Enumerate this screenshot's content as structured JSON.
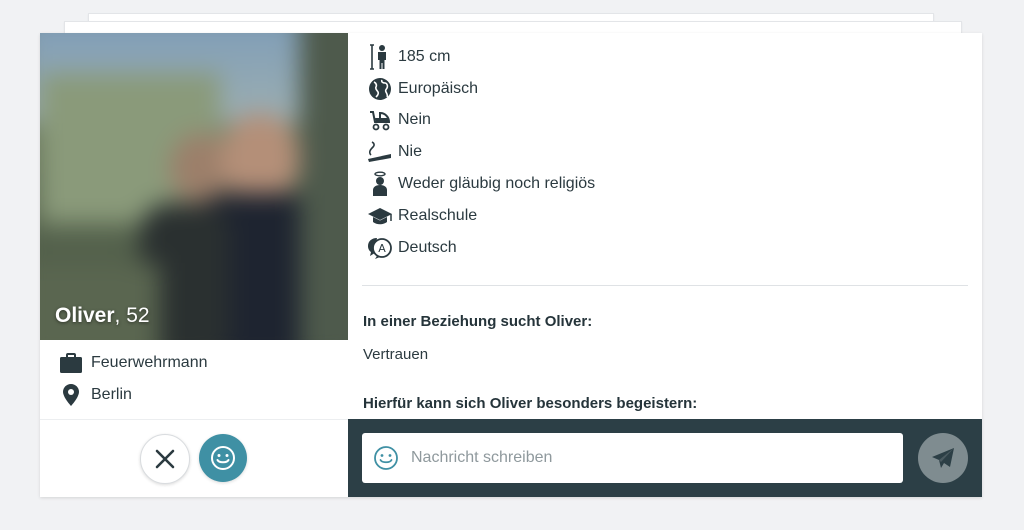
{
  "profile": {
    "name": "Oliver",
    "age_text": ", 52",
    "job": "Feuerwehrmann",
    "city": "Berlin"
  },
  "attributes": [
    {
      "icon": "height-icon",
      "text": "185 cm"
    },
    {
      "icon": "globe-icon",
      "text": "Europäisch"
    },
    {
      "icon": "stroller-icon",
      "text": "Nein"
    },
    {
      "icon": "cigarette-icon",
      "text": "Nie"
    },
    {
      "icon": "person-halo-icon",
      "text": "Weder gläubig noch religiös"
    },
    {
      "icon": "graduation-cap-icon",
      "text": "Realschule"
    },
    {
      "icon": "language-bubble-icon",
      "text": "Deutsch"
    }
  ],
  "sections": {
    "relationship_title": "In einer Beziehung sucht Oliver:",
    "relationship_text": "Vertrauen",
    "enthusiasm_title": "Hierfür kann sich Oliver besonders begeistern:"
  },
  "composer": {
    "placeholder": "Nachricht schreiben"
  },
  "colors": {
    "accent": "#3f90a4",
    "composer_bg": "#2c3f46",
    "send_button": "#7f8c90",
    "text": "#2b3a40"
  }
}
